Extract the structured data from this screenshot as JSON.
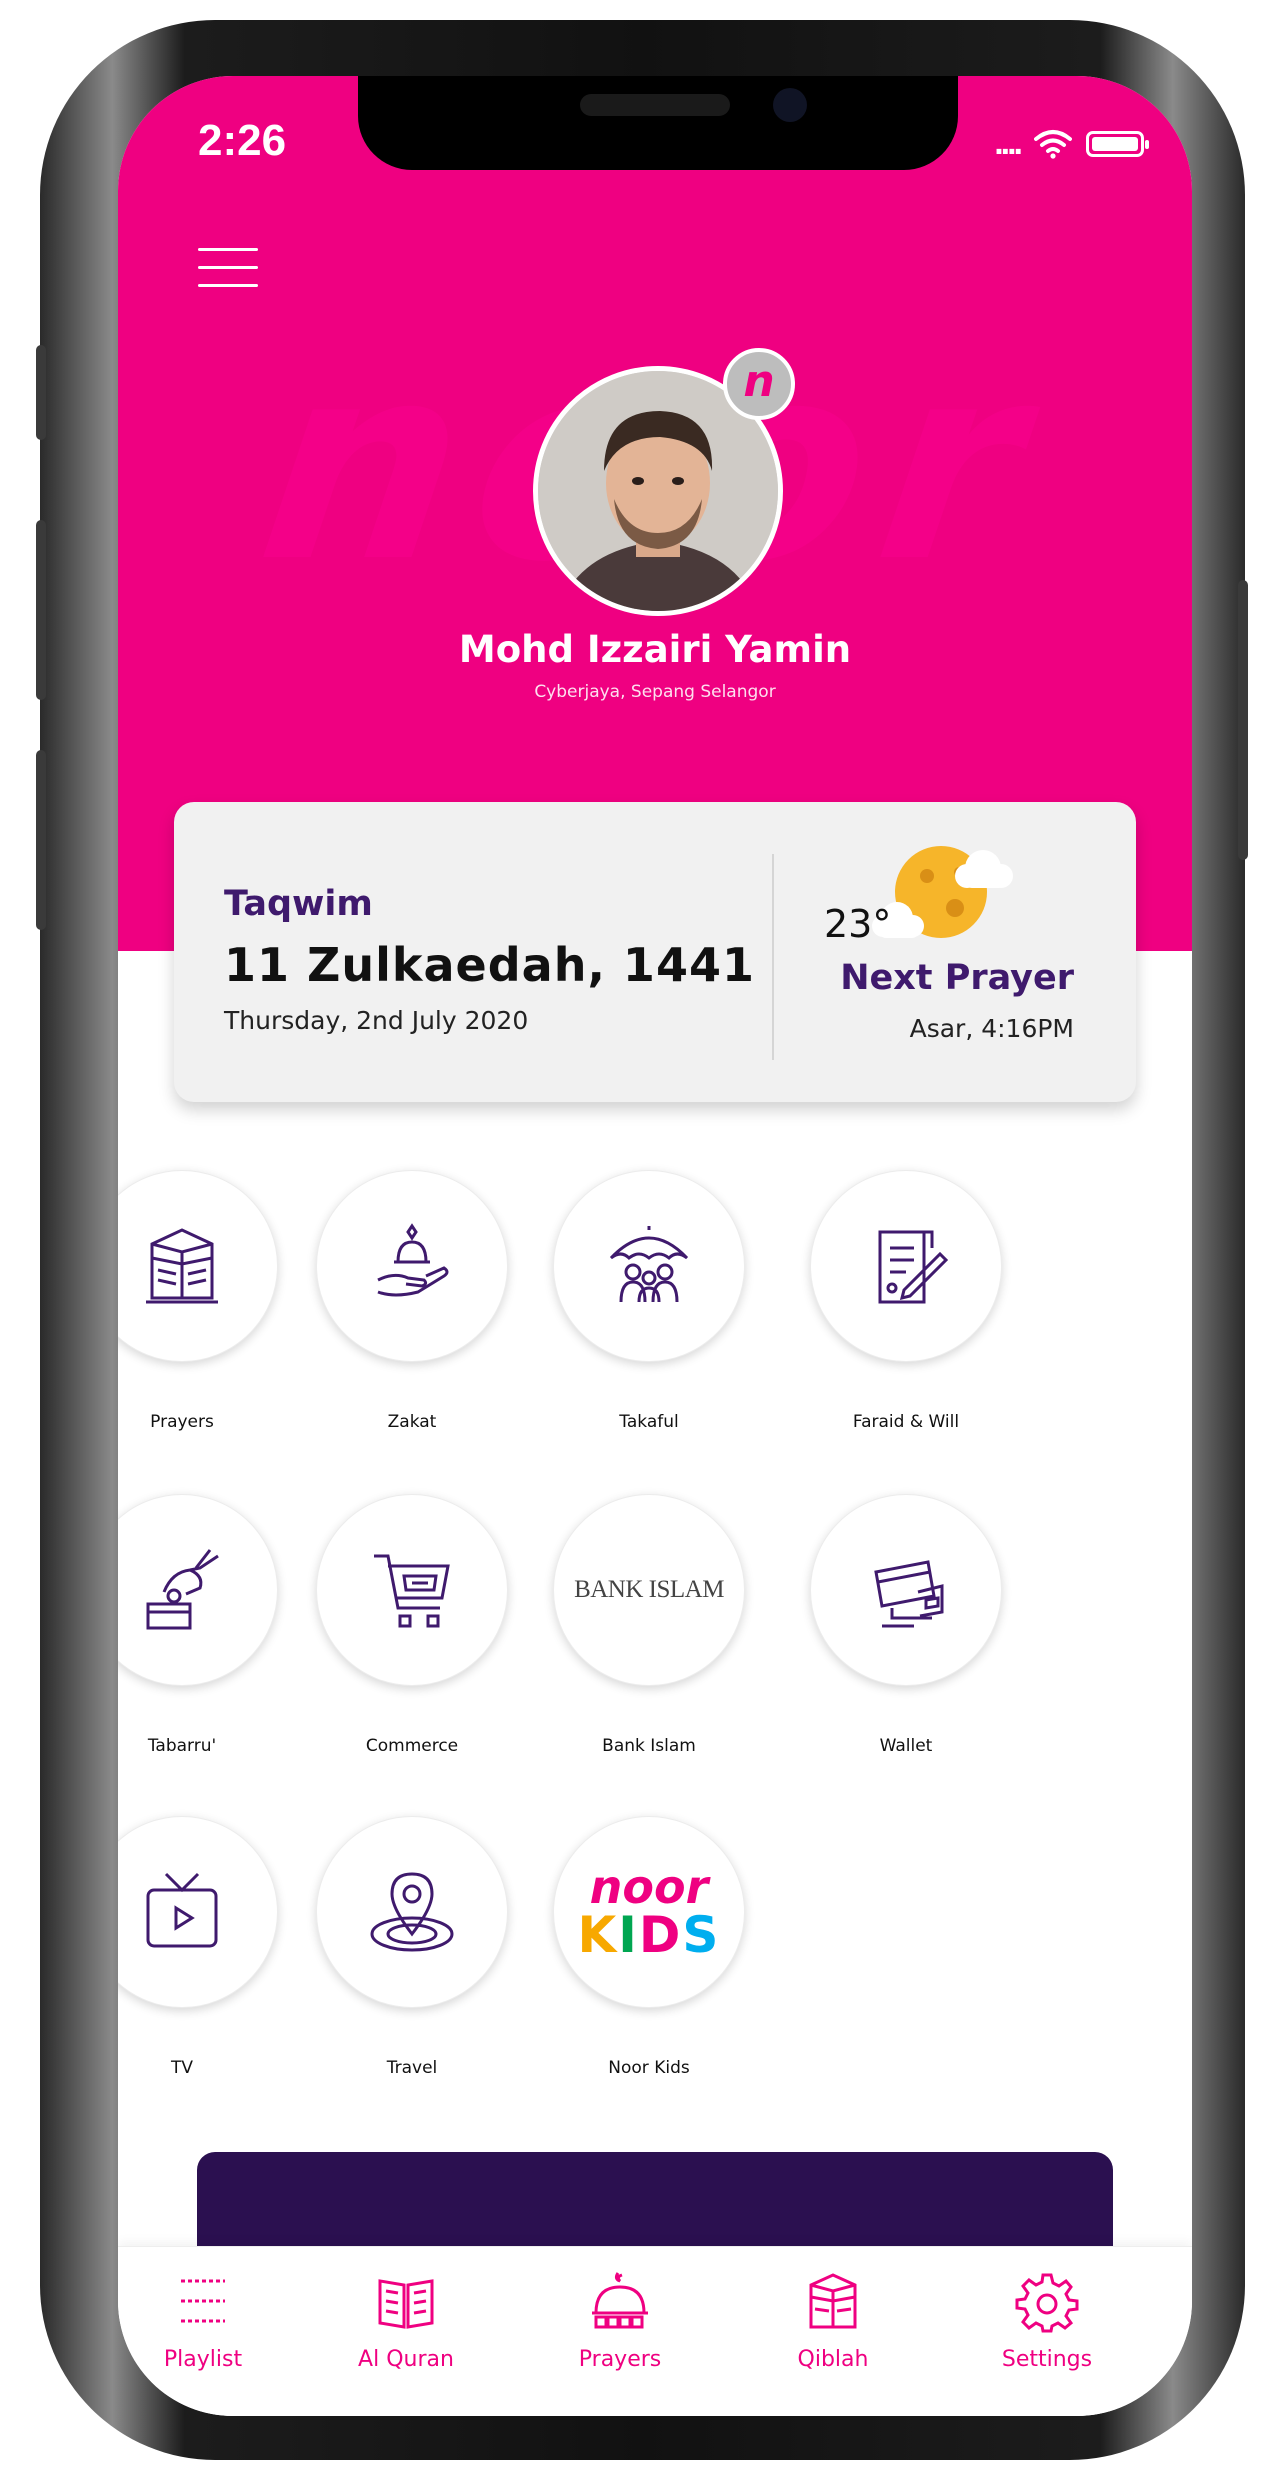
{
  "status_bar": {
    "time": "2:26",
    "signal": "....",
    "wifi_icon": "wifi-icon",
    "battery_icon": "battery-icon"
  },
  "colors": {
    "brand_pink": "#ef0081",
    "deep_purple": "#3f1a6d",
    "banner_purple": "#2b1050"
  },
  "header": {
    "menu_icon": "hamburger-menu-icon",
    "profile": {
      "name": "Mohd Izzairi Yamin",
      "location": "Cyberjaya, Sepang Selangor",
      "badge_letter": "n"
    }
  },
  "info_card": {
    "title": "Taqwim",
    "hijri_date": "11 Zulkaedah, 1441",
    "gregorian_date": "Thursday, 2nd July 2020",
    "temperature": "23°",
    "weather_icon": "moon-cloud-icon",
    "next_prayer_label": "Next Prayer",
    "next_prayer_value": "Asar, 4:16PM"
  },
  "menu": [
    {
      "label": "Prayers",
      "icon": "kaaba-icon"
    },
    {
      "label": "Zakat",
      "icon": "giving-hand-icon"
    },
    {
      "label": "Takaful",
      "icon": "umbrella-family-icon"
    },
    {
      "label": "Faraid & Will",
      "icon": "document-pen-icon"
    },
    {
      "label": "Tabarru'",
      "icon": "donation-box-icon"
    },
    {
      "label": "Commerce",
      "icon": "shopping-cart-icon"
    },
    {
      "label": "Bank Islam",
      "icon": "bank-islam-logo",
      "logo_text": "BANK ISLAM"
    },
    {
      "label": "Wallet",
      "icon": "wallet-card-icon"
    },
    {
      "label": "TV",
      "icon": "tv-icon"
    },
    {
      "label": "Travel",
      "icon": "location-pin-icon"
    },
    {
      "label": "Noor Kids",
      "icon": "noor-kids-logo",
      "logo_top": "noor",
      "logo_bottom": "KIDS"
    }
  ],
  "tabs": [
    {
      "label": "Playlist",
      "icon": "playlist-icon"
    },
    {
      "label": "Al Quran",
      "icon": "quran-book-icon"
    },
    {
      "label": "Prayers",
      "icon": "prayer-mosque-icon"
    },
    {
      "label": "Qiblah",
      "icon": "kaaba-icon"
    },
    {
      "label": "Settings",
      "icon": "gear-icon"
    }
  ]
}
